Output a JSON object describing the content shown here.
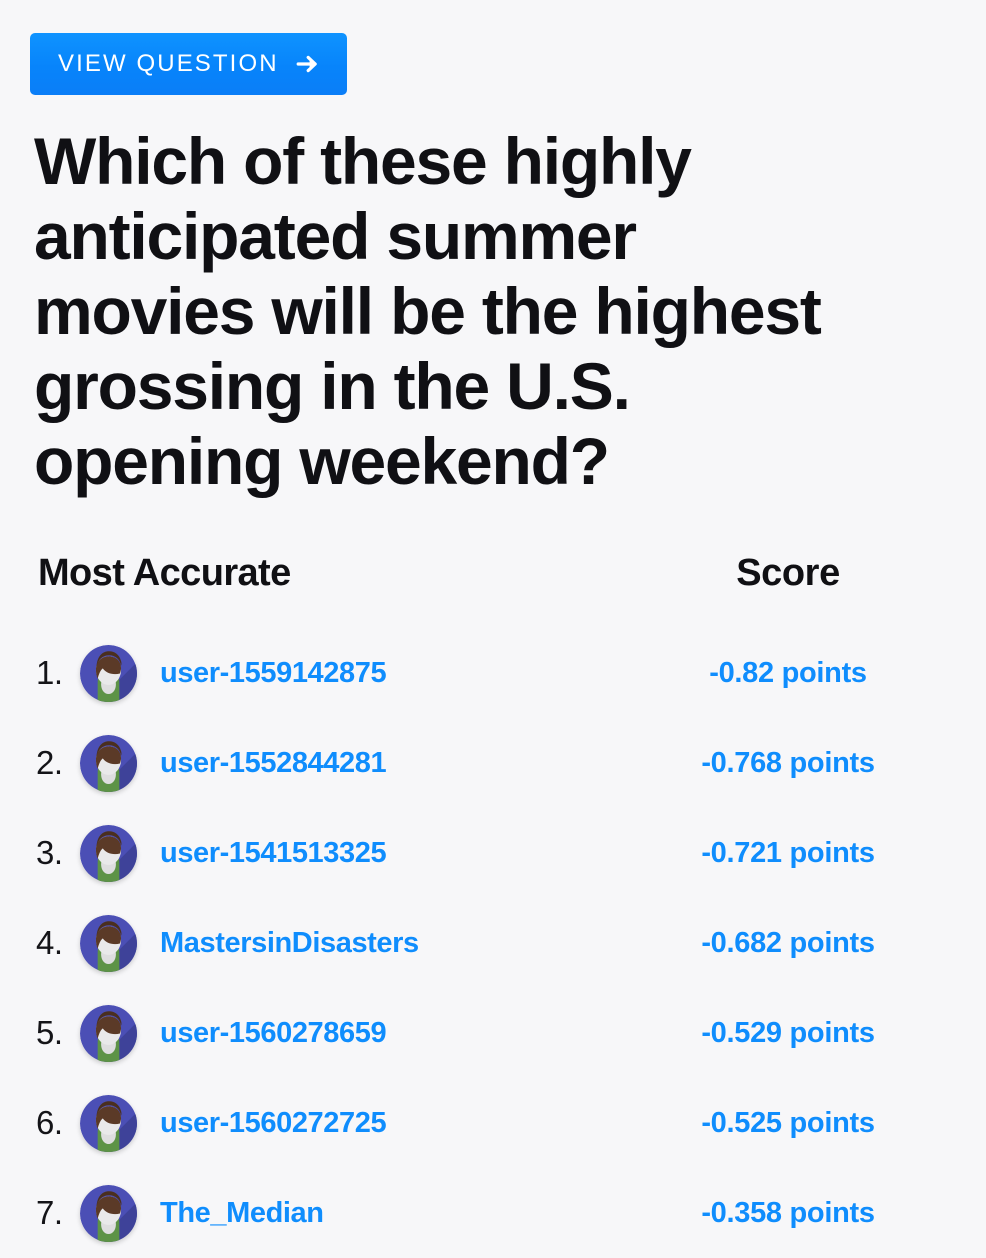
{
  "cta": {
    "label": "VIEW QUESTION",
    "arrow_icon": "arrow-right-icon"
  },
  "question": {
    "text": "Which of these highly anticipated summer movies will be the highest grossing in the U.S. opening weekend?"
  },
  "table": {
    "headers": {
      "name_column": "Most Accurate",
      "score_column": "Score"
    },
    "rows": [
      {
        "rank": "1.",
        "username": "user-1559142875",
        "score": "-0.82 points"
      },
      {
        "rank": "2.",
        "username": "user-1552844281",
        "score": "-0.768 points"
      },
      {
        "rank": "3.",
        "username": "user-1541513325",
        "score": "-0.721 points"
      },
      {
        "rank": "4.",
        "username": "MastersinDisasters",
        "score": "-0.682 points"
      },
      {
        "rank": "5.",
        "username": "user-1560278659",
        "score": "-0.529 points"
      },
      {
        "rank": "6.",
        "username": "user-1560272725",
        "score": "-0.525 points"
      },
      {
        "rank": "7.",
        "username": "The_Median",
        "score": "-0.358 points"
      }
    ]
  },
  "colors": {
    "page_background": "#f7f7f9",
    "accent_blue": "#0f8dfd",
    "button_blue_top": "#0f93ff",
    "button_blue_bottom": "#0b7ef7",
    "heading_text": "#101014",
    "avatar_background": "#4b4fb5",
    "avatar_hair": "#5b3a27",
    "avatar_face": "#e9e9ea",
    "avatar_shirt": "#5d9346"
  }
}
